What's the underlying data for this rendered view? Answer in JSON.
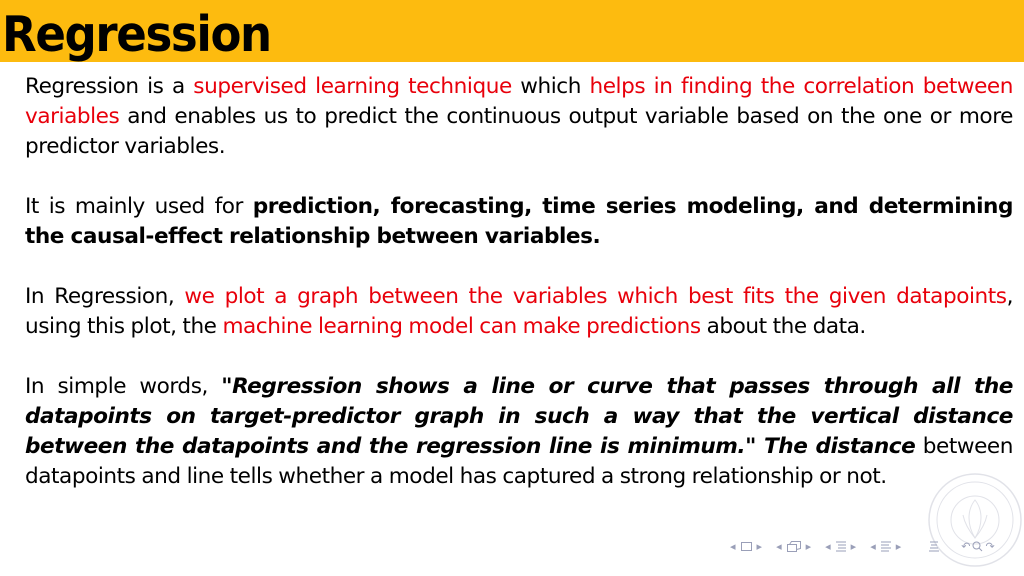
{
  "slide": {
    "title": "Regression",
    "accent_color": "#FDBB0F",
    "highlight_color": "#E8000B"
  },
  "paragraphs": [
    {
      "segments": [
        {
          "text": "Regression is a ",
          "style": "normal"
        },
        {
          "text": "supervised learning technique",
          "style": "red"
        },
        {
          "text": " which ",
          "style": "normal"
        },
        {
          "text": "helps in finding the correlation between variables",
          "style": "red"
        },
        {
          "text": " and enables us to predict the continuous output variable based on the one or more predictor variables.",
          "style": "normal"
        }
      ]
    },
    {
      "segments": [
        {
          "text": "It is mainly used for ",
          "style": "normal"
        },
        {
          "text": "prediction, forecasting, time series modeling, and determining the causal-effect relationship between variables.",
          "style": "bold"
        }
      ]
    },
    {
      "segments": [
        {
          "text": "In Regression, ",
          "style": "normal"
        },
        {
          "text": "we plot a graph between the variables which best fits the given datapoints",
          "style": "red"
        },
        {
          "text": ", using this plot, the ",
          "style": "normal"
        },
        {
          "text": "machine learning model can make predictions",
          "style": "red"
        },
        {
          "text": " about the data.",
          "style": "normal"
        }
      ]
    },
    {
      "segments": [
        {
          "text": "In simple words, ",
          "style": "normal"
        },
        {
          "text": "\"Regression shows a line or curve that passes through all the datapoints on target-predictor graph in such a way that the vertical distance between the datapoints and the regression line is minimum.\" The distance",
          "style": "bold-italic"
        },
        {
          "text": " between datapoints and line tells whether a model has captured a strong relationship or not.",
          "style": "normal"
        }
      ]
    }
  ],
  "navigation": {
    "icons": [
      "prev-frame-icon",
      "frame-icon",
      "next-frame-icon",
      "prev-subsection-icon",
      "subsection-icon",
      "next-subsection-icon",
      "prev-section-icon",
      "section-icon",
      "next-section-icon",
      "prev-slide-icon",
      "slide-icon",
      "next-slide-icon",
      "align-icon",
      "back-icon",
      "search-icon",
      "forward-icon"
    ]
  }
}
